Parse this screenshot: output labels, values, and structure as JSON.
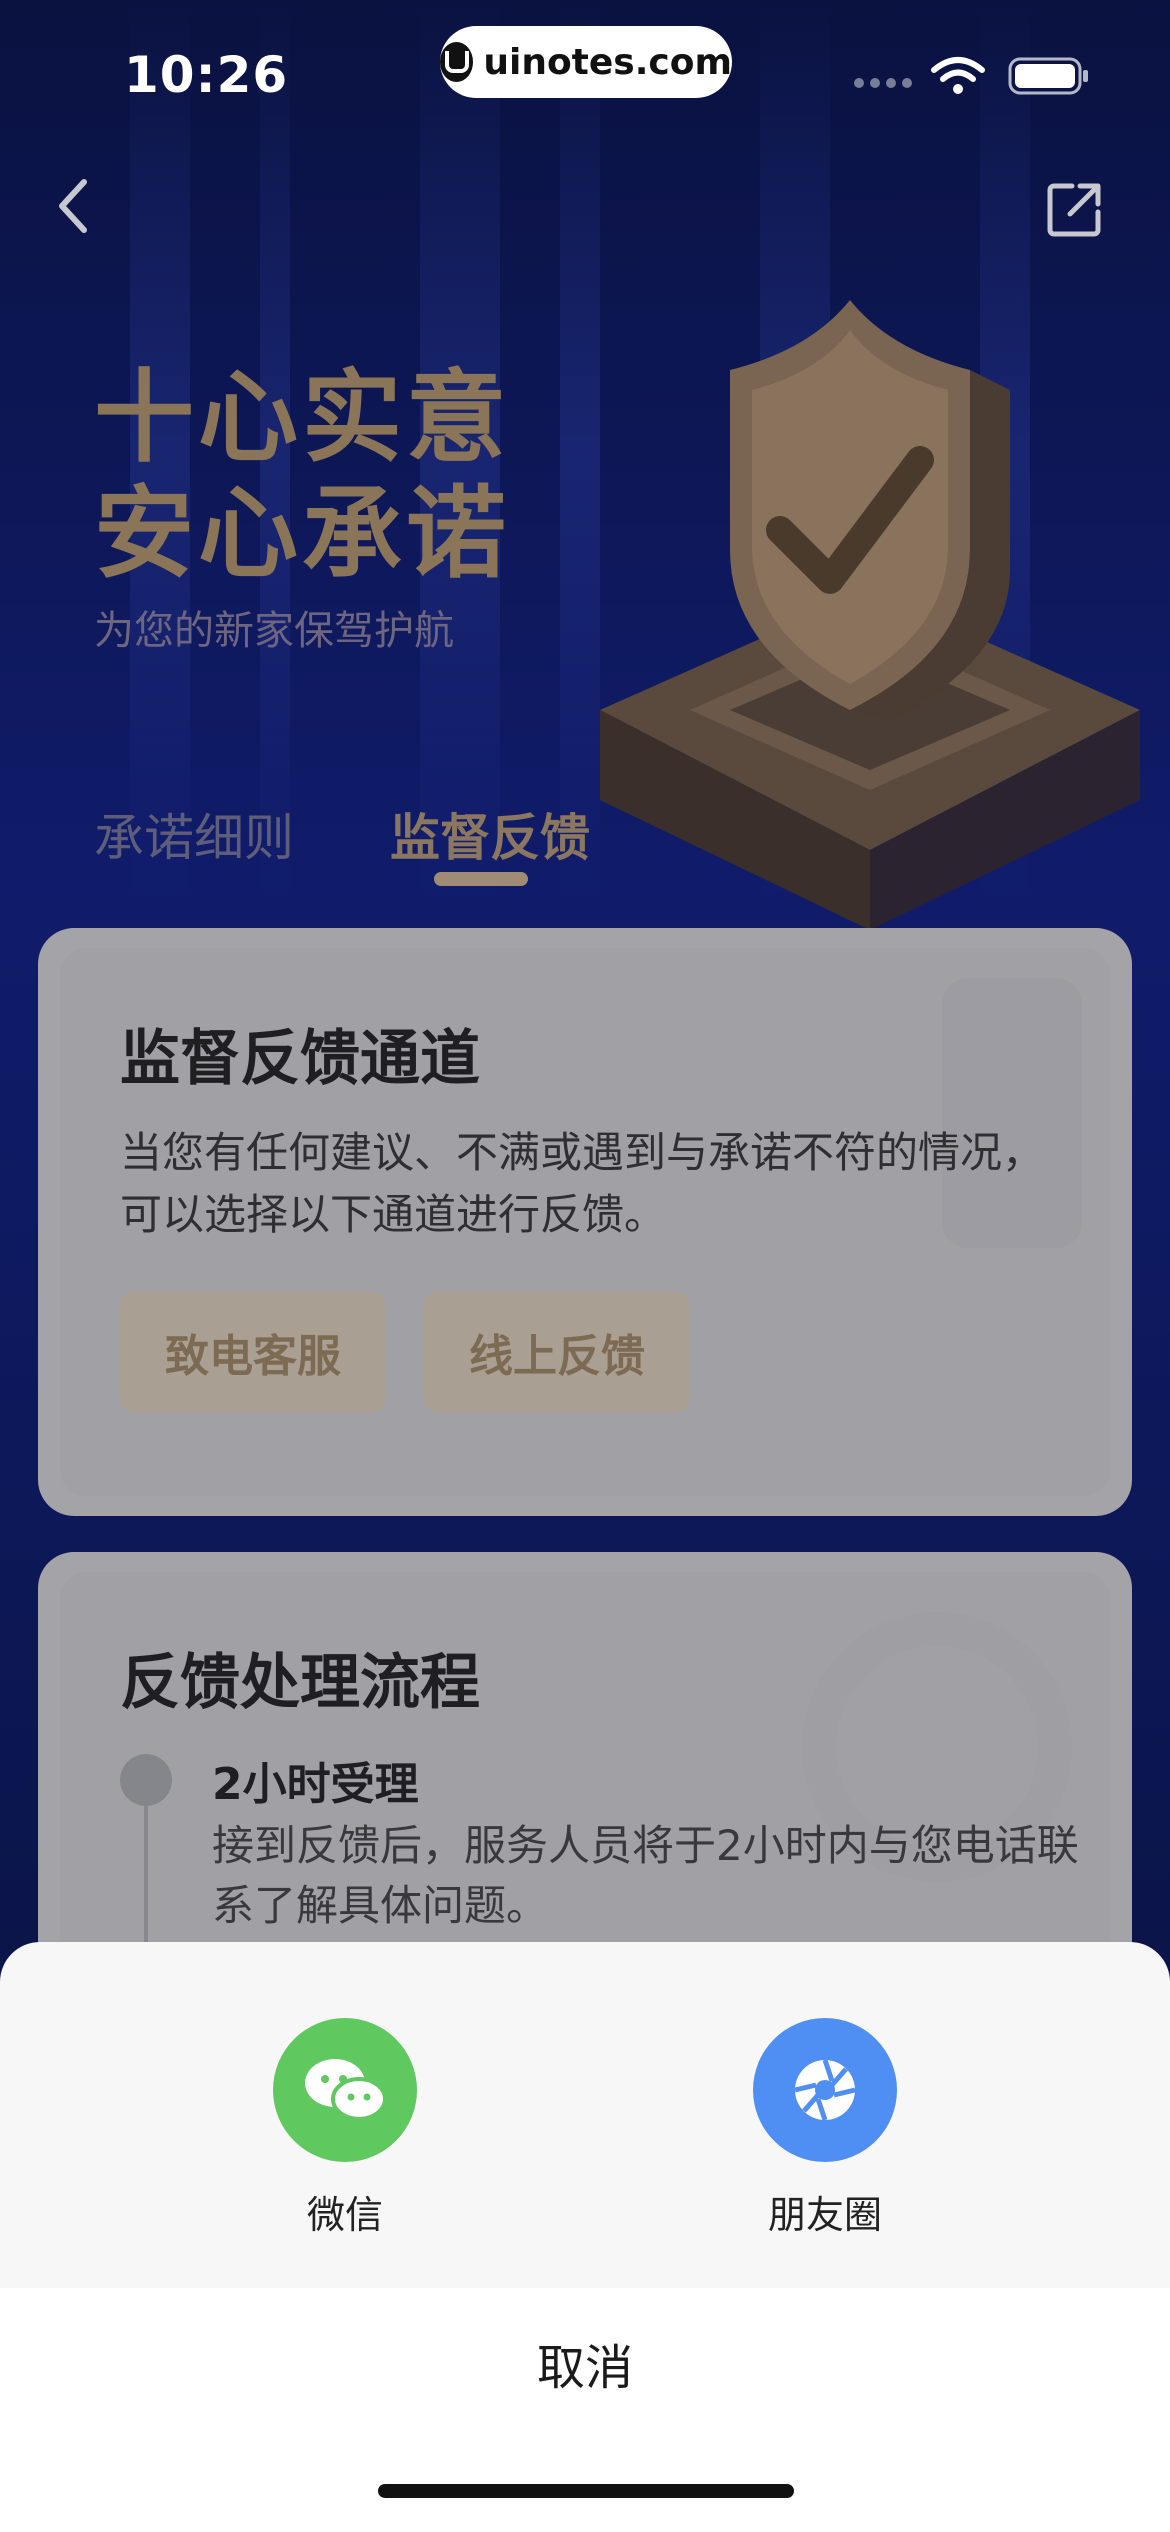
{
  "status_bar": {
    "time": "10:26",
    "url": "uinotes.com"
  },
  "hero": {
    "title_line1": "十心实意",
    "title_line2": "安心承诺",
    "subtitle": "为您的新家保驾护航"
  },
  "tabs": [
    {
      "label": "承诺细则",
      "active": false
    },
    {
      "label": "监督反馈",
      "active": true
    }
  ],
  "feedback_channel": {
    "title": "监督反馈通道",
    "description": "当您有任何建议、不满或遇到与承诺不符的情况，可以选择以下通道进行反馈。",
    "buttons": [
      "致电客服",
      "线上反馈"
    ]
  },
  "feedback_process": {
    "title": "反馈处理流程",
    "steps": [
      {
        "title": "2小时受理",
        "text": "接到反馈后，服务人员将于2小时内与您电话联系了解具体问题。"
      }
    ]
  },
  "share_sheet": {
    "options": [
      {
        "label": "微信",
        "icon": "wechat-icon",
        "color": "#5fc85f"
      },
      {
        "label": "朋友圈",
        "icon": "moments-icon",
        "color": "#4f8ef2"
      }
    ],
    "cancel_label": "取消"
  }
}
